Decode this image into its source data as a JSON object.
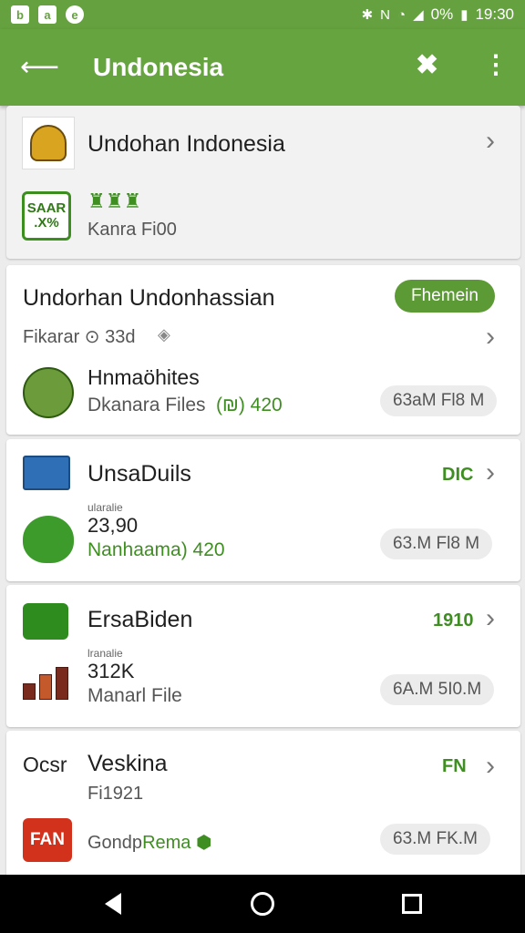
{
  "status_bar": {
    "battery": "0%",
    "time": "19:30"
  },
  "app_bar": {
    "title": "Undonesia"
  },
  "cards": [
    {
      "title": "Undohan Indonesia",
      "app_logo_text": "SAAR\n.X%",
      "sub": "Kanra Fi00"
    },
    {
      "title": "Undorhan Undonhassian",
      "badge": "Fhemein",
      "meta": "Fikarar ⊙ 33d",
      "item_title": "Hnmaöhites",
      "item_sub_label": "Dkanara Files",
      "item_sub_value": "420",
      "pill": "63aM Fl8 M"
    },
    {
      "title": "UnsaDuils",
      "tag": "DIC",
      "small_label": "ularalie",
      "value": "23,90",
      "sub": "Nanhaama) 420",
      "pill": "63.M Fl8 M"
    },
    {
      "title": "ErsaBiden",
      "tag": "1910",
      "small_label": "lranalie",
      "value": "312K",
      "sub": "Manarl File",
      "pill": "6A.M 5I0.M"
    },
    {
      "title": "Veskina",
      "logo_text": "Ocsr",
      "tag": "FN",
      "sub": "Fi1921",
      "app_badge": "FAN",
      "item_label_gray": "Gondp",
      "item_label_green": "Rema",
      "pill": "63.M FK.M"
    }
  ],
  "icons": {
    "status_left": [
      "b",
      "a",
      "e"
    ],
    "bluetooth": "bluetooth-icon",
    "chevron": "›"
  },
  "colors": {
    "primary": "#66a43f",
    "accent_text": "#3f8e22",
    "nav": "#000000"
  }
}
